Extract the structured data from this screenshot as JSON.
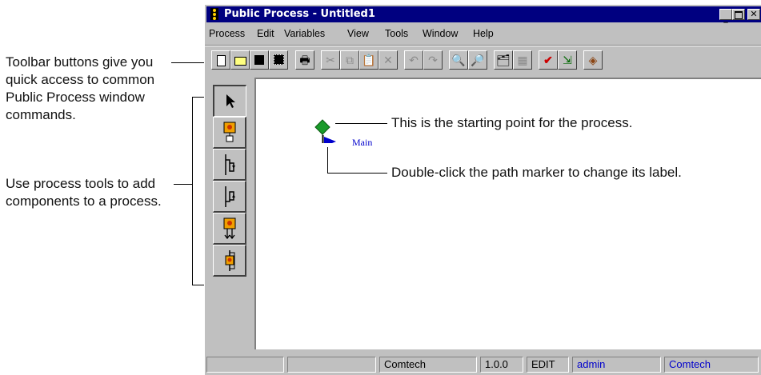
{
  "window": {
    "title": "Public Process - Untitled1",
    "controls": [
      "minimize",
      "maximize",
      "close"
    ]
  },
  "menu": [
    "Process",
    "Edit",
    "Variables",
    "View",
    "Tools",
    "Window",
    "Help"
  ],
  "toolbar": [
    {
      "name": "new-icon"
    },
    {
      "name": "open-icon"
    },
    {
      "name": "save-icon"
    },
    {
      "name": "save-all-icon"
    },
    {
      "name": "print-icon"
    },
    {
      "name": "cut-icon",
      "disabled": true
    },
    {
      "name": "copy-icon",
      "disabled": true
    },
    {
      "name": "paste-icon"
    },
    {
      "name": "delete-icon",
      "disabled": true
    },
    {
      "name": "undo-icon",
      "disabled": true
    },
    {
      "name": "redo-icon",
      "disabled": true
    },
    {
      "name": "zoom-out-icon"
    },
    {
      "name": "zoom-in-icon"
    },
    {
      "name": "properties-icon"
    },
    {
      "name": "layout-icon",
      "disabled": true
    },
    {
      "name": "validate-icon"
    },
    {
      "name": "deploy-icon"
    },
    {
      "name": "help-book-icon"
    }
  ],
  "palette": [
    "pointer-tool-icon",
    "activity-tool-icon",
    "split-path-tool-icon",
    "join-path-tool-icon",
    "loop-tool-icon",
    "subprocess-tool-icon"
  ],
  "canvas": {
    "path_label": "Main",
    "start_color": "#1a9a2a",
    "flag_color": "#0000cc"
  },
  "status": [
    "",
    "",
    "Comtech",
    "1.0.0",
    "EDIT",
    "admin",
    "Comtech"
  ],
  "status_colors": {
    "admin": "#0000cc",
    "comtech_last": "#0000cc"
  },
  "callouts": {
    "toolbar": [
      "Toolbar buttons give you",
      "quick access to common",
      "Public Process window",
      "commands."
    ],
    "tools": [
      "Use process tools to add",
      "components to a process."
    ],
    "start": "This is the starting point for the process.",
    "marker": "Double-click the path marker to change its label."
  },
  "colors": {
    "titlebar": "#000080",
    "chrome": "#c0c0c0"
  }
}
